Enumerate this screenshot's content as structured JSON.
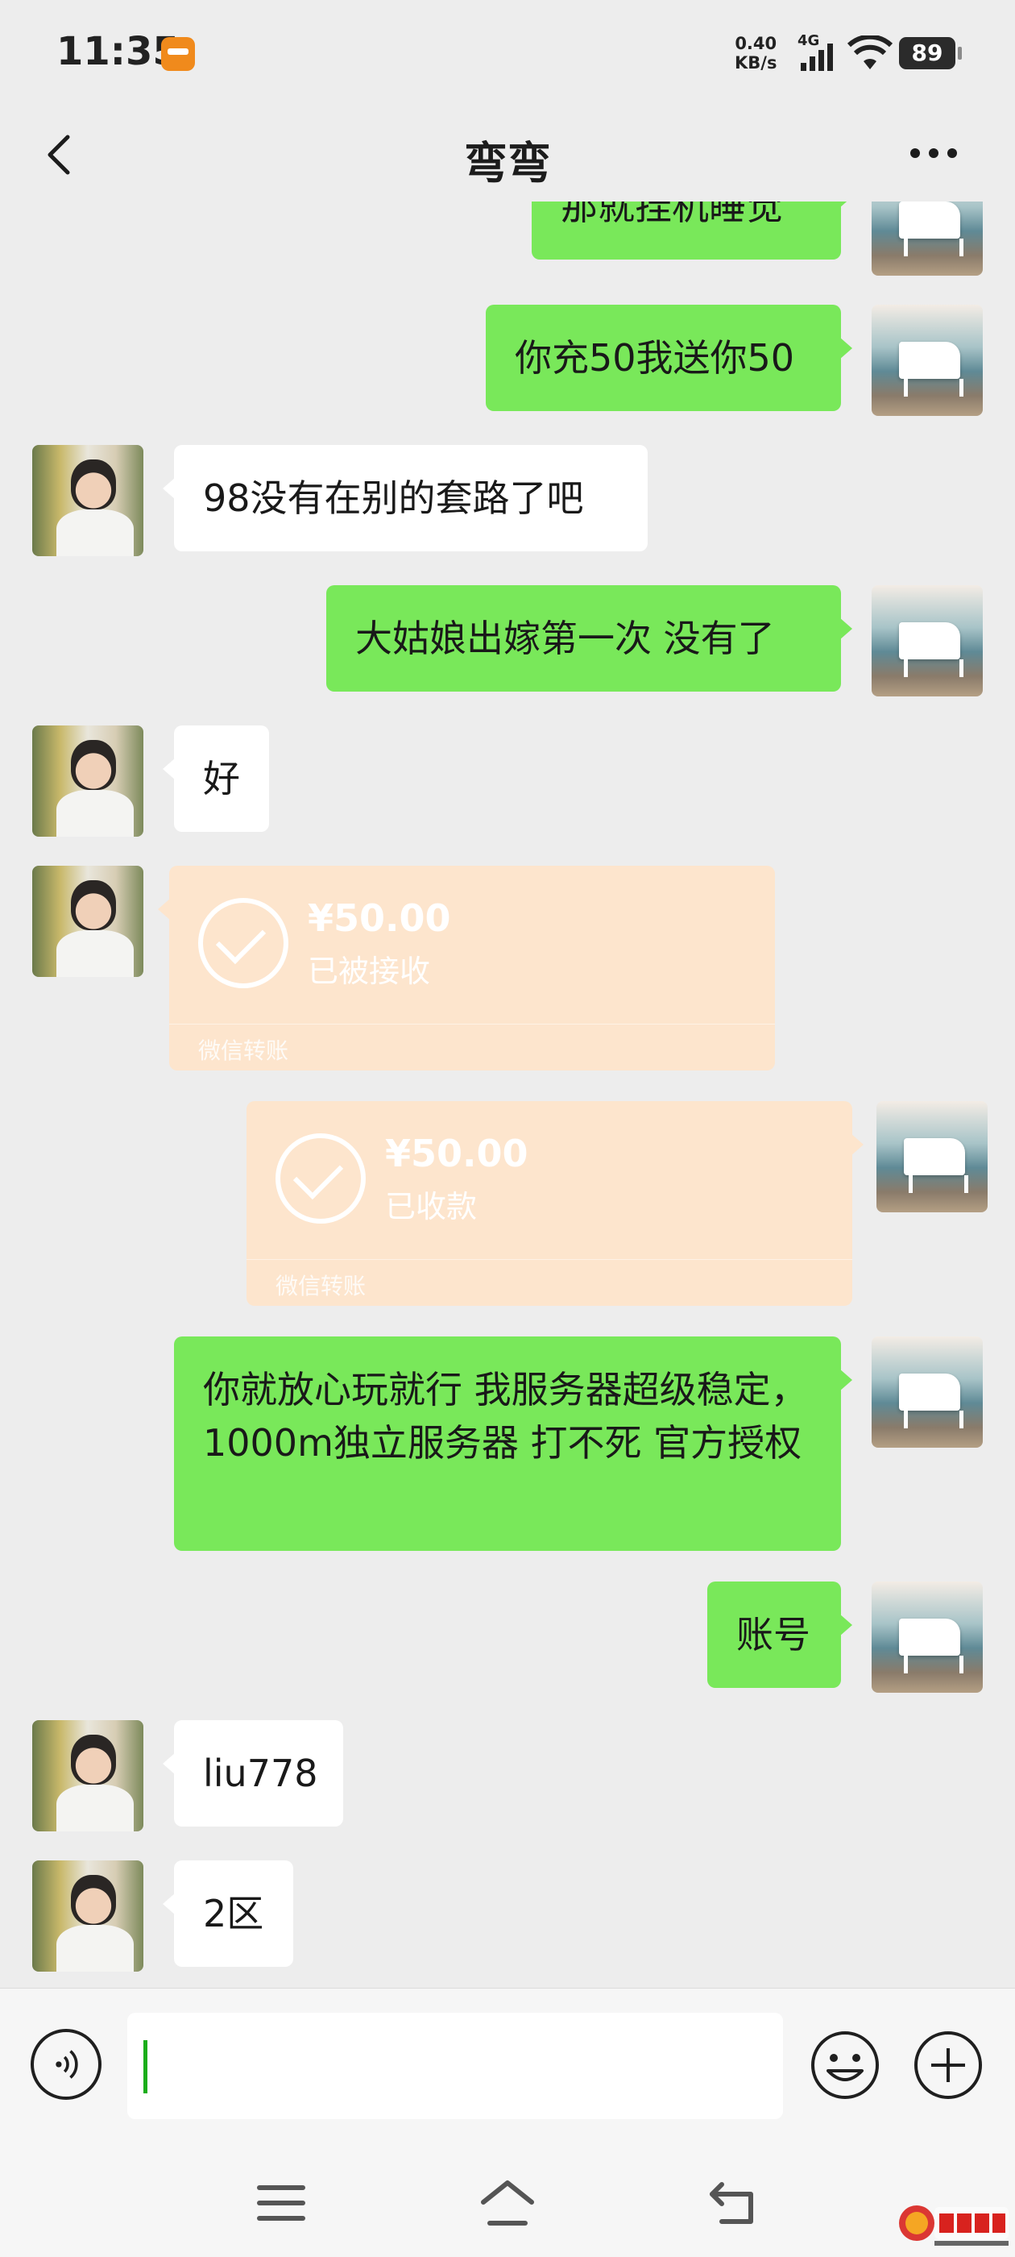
{
  "status_bar": {
    "time": "11:35",
    "net_speed_value": "0.40",
    "net_speed_unit": "KB/s",
    "network": "4G",
    "battery": "89"
  },
  "header": {
    "title": "弯弯"
  },
  "messages": [
    {
      "sender": "self",
      "text": "那就挂机睡觉"
    },
    {
      "sender": "self",
      "text": "你充50我送你50"
    },
    {
      "sender": "peer",
      "text": "98没有在别的套路了吧"
    },
    {
      "sender": "self",
      "text": "大姑娘出嫁第一次 没有了"
    },
    {
      "sender": "peer",
      "text": "好"
    },
    {
      "sender": "peer",
      "type": "transfer",
      "amount": "¥50.00",
      "status": "已被接收",
      "footer": "微信转账"
    },
    {
      "sender": "self",
      "type": "transfer",
      "amount": "¥50.00",
      "status": "已收款",
      "footer": "微信转账"
    },
    {
      "sender": "self",
      "text": "你就放心玩就行 我服务器超级稳定，1000m独立服务器 打不死 官方授权"
    },
    {
      "sender": "self",
      "text": "账号"
    },
    {
      "sender": "peer",
      "text": "liu778"
    },
    {
      "sender": "peer",
      "text": "2区"
    }
  ],
  "input": {
    "value": ""
  },
  "watermark": {
    "logo_text": "萝卜论坛",
    "url": "bbs.0lb.com"
  },
  "colors": {
    "background": "#ededed",
    "self_bubble": "#79e85a",
    "peer_bubble": "#ffffff",
    "transfer_card": "#fde5cd",
    "cursor": "#1aad19"
  }
}
